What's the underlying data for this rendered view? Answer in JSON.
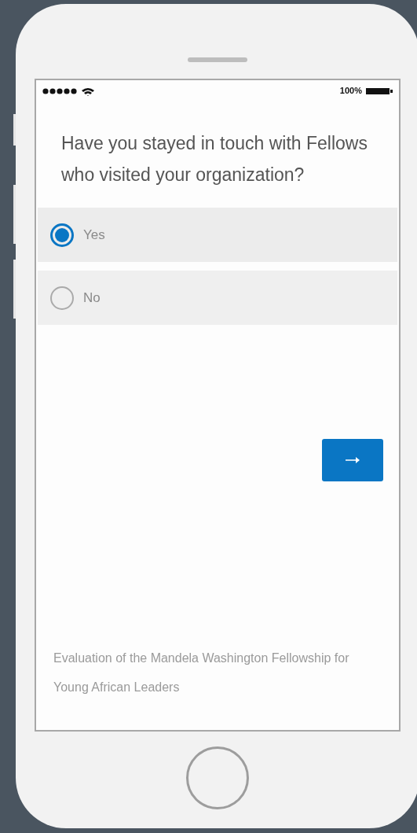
{
  "status_bar": {
    "battery": "100%"
  },
  "question": "Have you stayed in touch with Fellows who visited your organization?",
  "options": [
    {
      "label": "Yes",
      "selected": true
    },
    {
      "label": "No",
      "selected": false
    }
  ],
  "footer": "Evaluation of the Mandela Washington Fellowship for Young African Leaders"
}
